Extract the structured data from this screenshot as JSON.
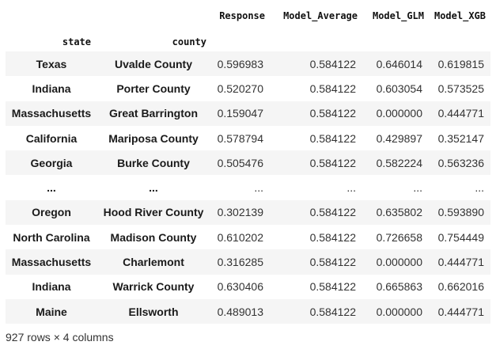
{
  "table": {
    "columns": [
      "Response",
      "Model_Average",
      "Model_GLM",
      "Model_XGB"
    ],
    "index_names": [
      "state",
      "county"
    ],
    "rows": [
      {
        "state": "Texas",
        "county": "Uvalde County",
        "values": [
          "0.596983",
          "0.584122",
          "0.646014",
          "0.619815"
        ]
      },
      {
        "state": "Indiana",
        "county": "Porter County",
        "values": [
          "0.520270",
          "0.584122",
          "0.603054",
          "0.573525"
        ]
      },
      {
        "state": "Massachusetts",
        "county": "Great Barrington",
        "values": [
          "0.159047",
          "0.584122",
          "0.000000",
          "0.444771"
        ]
      },
      {
        "state": "California",
        "county": "Mariposa County",
        "values": [
          "0.578794",
          "0.584122",
          "0.429897",
          "0.352147"
        ]
      },
      {
        "state": "Georgia",
        "county": "Burke County",
        "values": [
          "0.505476",
          "0.584122",
          "0.582224",
          "0.563236"
        ]
      },
      {
        "state": "...",
        "county": "...",
        "values": [
          "...",
          "...",
          "...",
          "..."
        ]
      },
      {
        "state": "Oregon",
        "county": "Hood River County",
        "values": [
          "0.302139",
          "0.584122",
          "0.635802",
          "0.593890"
        ]
      },
      {
        "state": "North Carolina",
        "county": "Madison County",
        "values": [
          "0.610202",
          "0.584122",
          "0.726658",
          "0.754449"
        ]
      },
      {
        "state": "Massachusetts",
        "county": "Charlemont",
        "values": [
          "0.316285",
          "0.584122",
          "0.000000",
          "0.444771"
        ]
      },
      {
        "state": "Indiana",
        "county": "Warrick County",
        "values": [
          "0.630406",
          "0.584122",
          "0.665863",
          "0.662016"
        ]
      },
      {
        "state": "Maine",
        "county": "Ellsworth",
        "values": [
          "0.489013",
          "0.584122",
          "0.000000",
          "0.444771"
        ]
      }
    ]
  },
  "footer": "927 rows × 4 columns"
}
